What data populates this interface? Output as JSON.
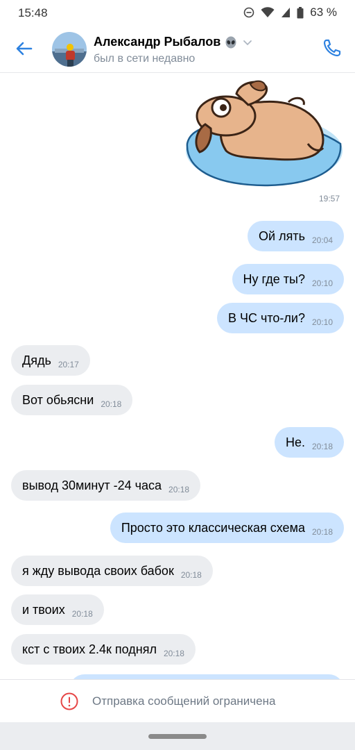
{
  "status_bar": {
    "time": "15:48",
    "battery": "63 %"
  },
  "header": {
    "contact_name": "Александр Рыбалов",
    "contact_status": "был в сети недавно",
    "icons": [
      "back-arrow-icon",
      "alien-icon",
      "chevron-down-icon",
      "phone-icon"
    ]
  },
  "chat": {
    "sticker_time": "19:57",
    "messages": [
      {
        "dir": "out",
        "text": "Ой лять",
        "time": "20:04"
      },
      {
        "dir": "out",
        "text": "Ну где ты?",
        "time": "20:10"
      },
      {
        "dir": "out",
        "text": "В ЧС что-ли?",
        "time": "20:10"
      },
      {
        "dir": "in",
        "text": "Дядь",
        "time": "20:17"
      },
      {
        "dir": "in",
        "text": "Вот обьясни",
        "time": "20:18"
      },
      {
        "dir": "out",
        "text": "Не.",
        "time": "20:18"
      },
      {
        "dir": "in",
        "text": "вывод 30минут -24 часа",
        "time": "20:18"
      },
      {
        "dir": "out",
        "text": "Просто это классическая схема",
        "time": "20:18"
      },
      {
        "dir": "in",
        "text": "я жду вывода своих бабок",
        "time": "20:18"
      },
      {
        "dir": "in",
        "text": "и твоих",
        "time": "20:18"
      },
      {
        "dir": "in",
        "text": "кст с твоих 2.4к поднял",
        "time": "20:18"
      }
    ]
  },
  "footer": {
    "restricted_text": "Отправка сообщений ограничена"
  },
  "colors": {
    "accent": "#2d81e0",
    "outgoing_bubble": "#cce4ff",
    "incoming_bubble": "#ebedf0",
    "error": "#e64646"
  }
}
